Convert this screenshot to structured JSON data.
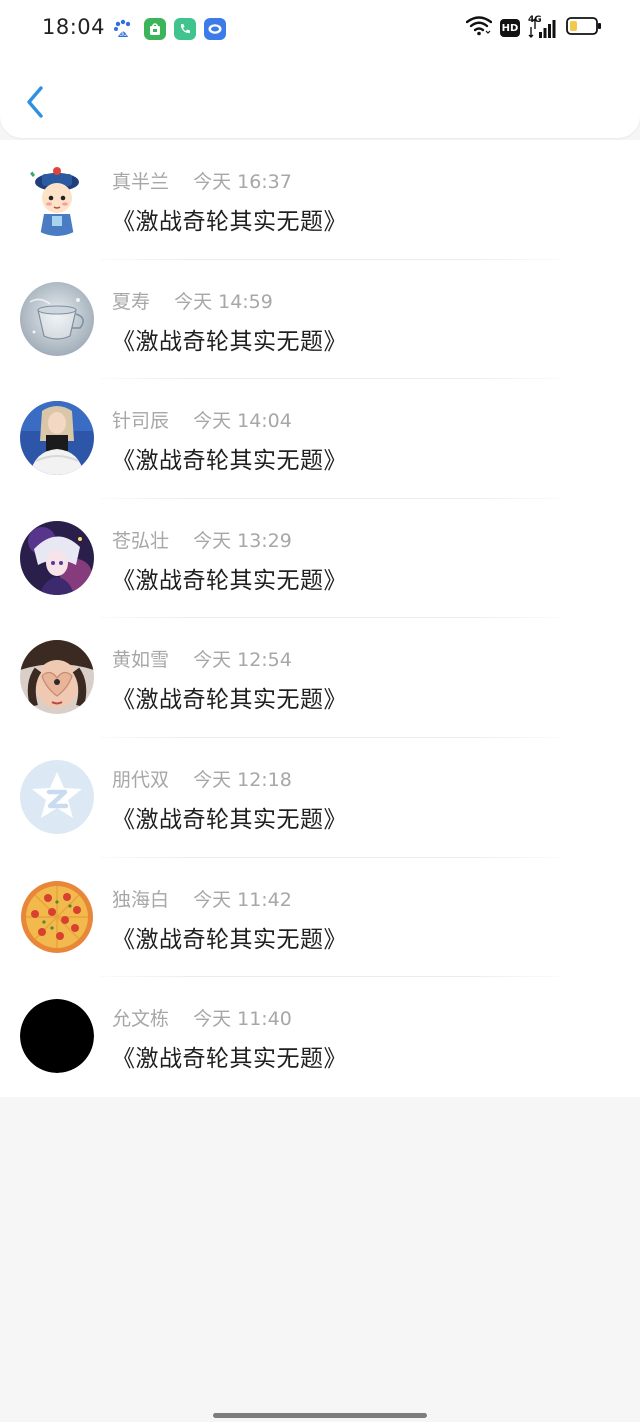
{
  "status_bar": {
    "time": "18:04",
    "network_type": "4G",
    "hd_badge": "HD",
    "notification_icons": [
      "baidu-icon",
      "shop-bag-icon",
      "phone-icon",
      "cloud-chat-icon"
    ],
    "battery_level": 0.2
  },
  "header": {
    "back_icon": "chevron-left-icon",
    "accent_color": "#2f8fe0"
  },
  "messages": [
    {
      "name": "真半兰",
      "time": "今天 16:37",
      "content": "《激战奇轮其实无题》",
      "avatar": "qing-official-cartoon"
    },
    {
      "name": "夏寿",
      "time": "今天 14:59",
      "content": "《激战奇轮其实无题》",
      "avatar": "glass-cup"
    },
    {
      "name": "针司辰",
      "time": "今天 14:04",
      "content": "《激战奇轮其实无题》",
      "avatar": "girl-photo"
    },
    {
      "name": "苍弘壮",
      "time": "今天 13:29",
      "content": "《激战奇轮其实无题》",
      "avatar": "anime-character"
    },
    {
      "name": "黄如雪",
      "time": "今天 12:54",
      "content": "《激战奇轮其实无题》",
      "avatar": "heart-hands-photo"
    },
    {
      "name": "朋代双",
      "time": "今天 12:18",
      "content": "《激战奇轮其实无题》",
      "avatar": "default-star-z"
    },
    {
      "name": "独海白",
      "time": "今天 11:42",
      "content": "《激战奇轮其实无题》",
      "avatar": "pizza"
    },
    {
      "name": "允文栋",
      "time": "今天 11:40",
      "content": "《激战奇轮其实无题》",
      "avatar": "black-circle"
    }
  ]
}
